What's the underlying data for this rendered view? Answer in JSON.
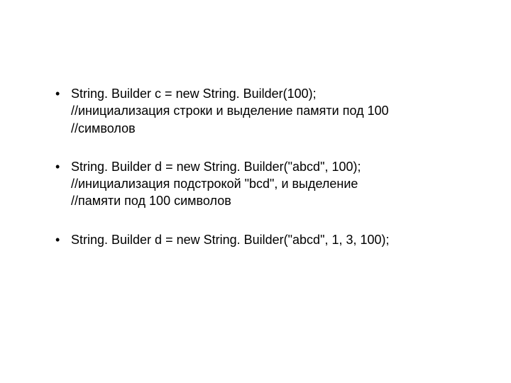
{
  "bullets": [
    {
      "lines": [
        "String. Builder c = new String. Builder(100);",
        "//инициализация строки и выделение памяти под 100",
        "//символов"
      ]
    },
    {
      "lines": [
        "String. Builder d = new String. Builder(\"abcd\", 100);",
        "//инициализация подстрокой \"bcd\", и выделение",
        "//памяти под 100 символов"
      ]
    },
    {
      "lines": [
        "String. Builder d = new String. Builder(\"abcd\", 1, 3, 100);"
      ]
    }
  ]
}
